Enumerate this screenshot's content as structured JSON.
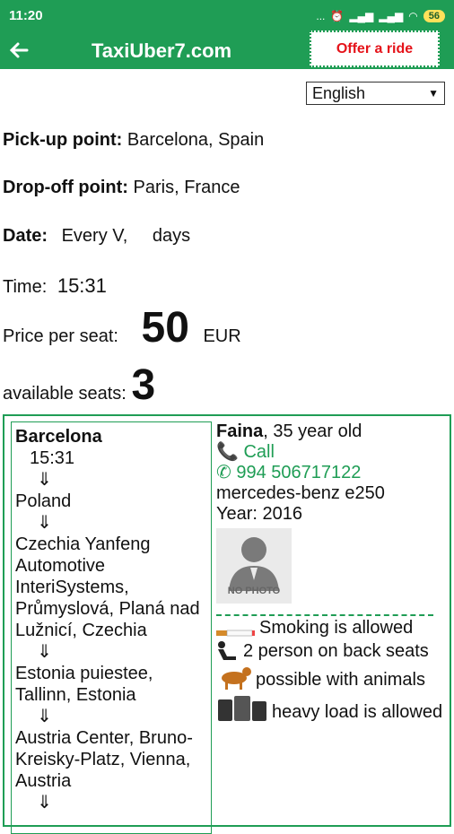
{
  "status": {
    "time": "11:20",
    "dots": "...",
    "battery": "56"
  },
  "app": {
    "title": "TaxiUber7.com",
    "offer_label": "Offer a ride"
  },
  "language": {
    "selected": "English"
  },
  "ride": {
    "pickup_label": "Pick-up point:",
    "pickup_value": "Barcelona, Spain",
    "dropoff_label": "Drop-off point:",
    "dropoff_value": "Paris, France",
    "date_label": "Date:",
    "date_value": "Every V,",
    "date_suffix": "days",
    "time_label": "Time:",
    "time_value": "15:31",
    "price_label": "Price per seat:",
    "price_value": "50",
    "price_currency": "EUR",
    "seats_label": "available seats:",
    "seats_value": "3"
  },
  "route": {
    "start": "Barcelona",
    "start_time": "15:31",
    "arrow": "⇓",
    "stops": [
      "Poland",
      "Czechia Yanfeng Automotive InteriSystems, Průmyslová, Planá nad Lužnicí, Czechia",
      "Estonia puiestee, Tallinn, Estonia",
      "Austria Center, Bruno-Kreisky-Platz, Vienna, Austria"
    ]
  },
  "driver": {
    "name": "Faina",
    "age": ", 35 year old",
    "call_label": "Call",
    "whatsapp": "994 506717122",
    "car": "mercedes-benz e250",
    "year": "Year: 2016",
    "photo_caption": "NO PHOTO",
    "features": [
      {
        "icon": "cigarette-icon",
        "text": "Smoking is allowed"
      },
      {
        "icon": "car-seat-icon",
        "text": "2 person on back seats"
      },
      {
        "icon": "dog-icon",
        "text": "possible with animals"
      },
      {
        "icon": "luggage-icon",
        "text": "heavy load is allowed"
      }
    ]
  }
}
